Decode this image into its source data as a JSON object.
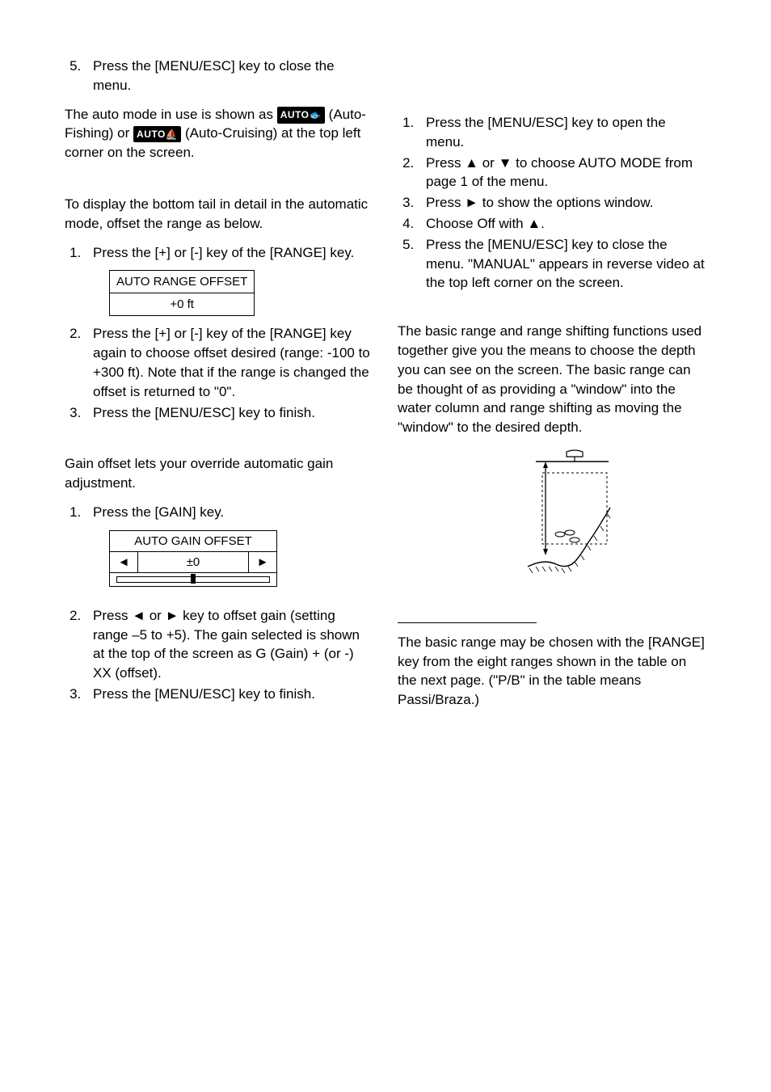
{
  "left": {
    "step5_close": "Press the [MENU/ESC] key to close the menu.",
    "auto_mode_pre": "The auto mode in use is shown as ",
    "auto_fishing": "(Auto-Fishing) or ",
    "auto_cruising": " (Auto-Cruising) at the top left corner on the screen.",
    "display_bottom": "To display the bottom tail in detail in the automatic mode, offset the range as below.",
    "range_step1": "Press the [+] or [-] key of the [RANGE] key.",
    "range_box_header": "AUTO RANGE OFFSET",
    "range_box_value": "+0 ft",
    "range_step2": "Press the [+] or [-] key of the [RANGE] key again to choose offset desired (range: -100 to +300 ft). Note that if the range is changed the offset is returned to \"0\".",
    "range_step3": "Press the [MENU/ESC] key to finish.",
    "gain_offset_intro": "Gain offset lets your override automatic gain adjustment.",
    "gain_step1": "Press the [GAIN] key.",
    "gain_box_header": "AUTO GAIN OFFSET",
    "gain_box_value": "±0",
    "gain_arrow_left": "◄",
    "gain_arrow_right": "►",
    "gain_step2": "Press ◄ or ► key to offset gain (setting range –5 to +5). The gain selected is shown at the top of the screen as G (Gain) + (or -) XX (offset).",
    "gain_step3": "Press the [MENU/ESC] key to finish."
  },
  "right": {
    "step1": "Press the [MENU/ESC] key to open the menu.",
    "step2": "Press ▲ or ▼ to choose AUTO MODE from page 1 of the menu.",
    "step3": "Press ► to show the options window.",
    "step4": "Choose Off with ▲.",
    "step5": "Press the [MENU/ESC] key to close the menu. \"MANUAL\" appears in reverse video at the top left corner on the screen.",
    "basic_range_intro": "The basic range and range shifting functions used together give you the means to choose the depth you can see on the screen. The basic range can be thought of as providing a \"window\" into the water column and range shifting as moving the \"window\" to the desired depth.",
    "basic_range_para": "The basic range may be chosen with the [RANGE] key from the eight ranges shown in the table on the next page. (\"P/B\" in the table means Passi/Braza.)"
  },
  "icons": {
    "auto_fish": "AUTO",
    "auto_cruise": "AUTO"
  }
}
